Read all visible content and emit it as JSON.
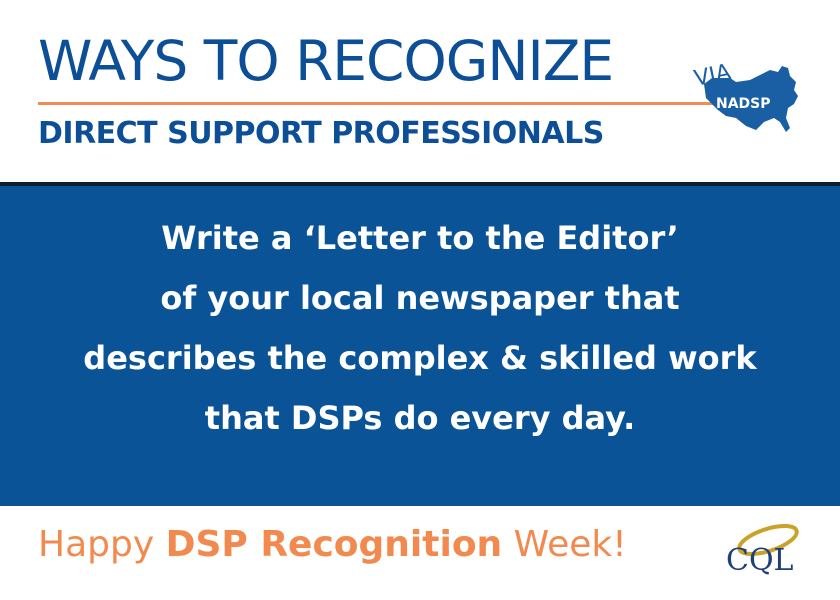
{
  "header": {
    "title": "WAYS TO RECOGNIZE",
    "subtitle": "DIRECT SUPPORT PROFESSIONALS",
    "via_logo": {
      "via_text": "VIA",
      "org_text": "NADSP",
      "map_color": "#1a5fa3",
      "via_color": "#1a5fa3"
    }
  },
  "panel": {
    "lines": [
      "Write a ‘Letter to the Editor’",
      "of your local newspaper that",
      "describes the complex & skilled work",
      "that DSPs do every day."
    ],
    "background": "#0b5397"
  },
  "footer": {
    "greeting_part1": "Happy ",
    "greeting_bold": "DSP Recognition",
    "greeting_part2": " Week!",
    "greeting_color": "#f28a4f",
    "cql_logo": {
      "text": "CQL",
      "swoosh_color": "#c9a227",
      "text_color": "#1d3f7a"
    }
  },
  "colors": {
    "brand_blue": "#0d4f96",
    "accent_orange": "#ef8d55"
  }
}
